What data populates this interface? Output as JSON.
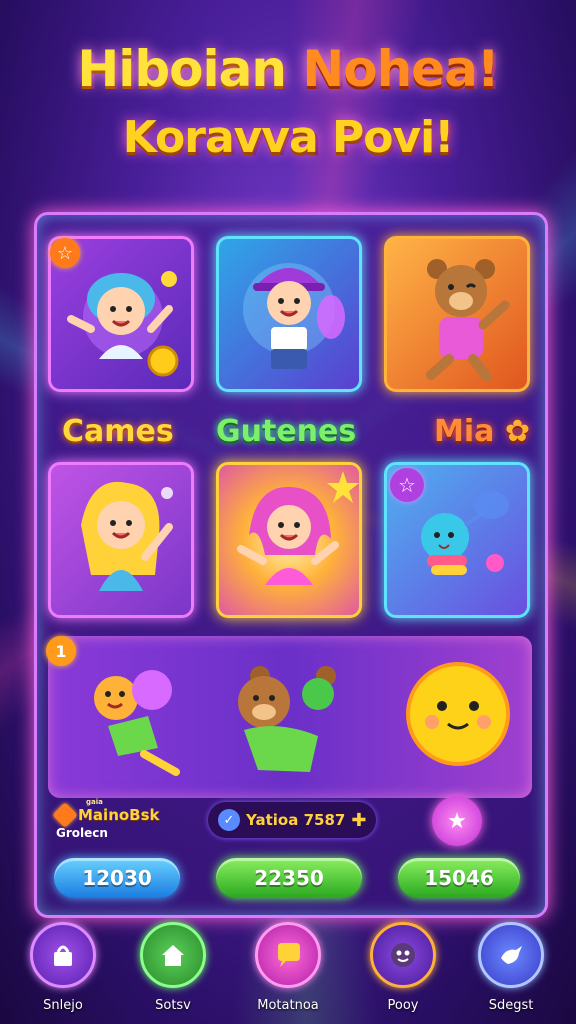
{
  "title": {
    "line1_a": "Hiboian",
    "line1_b": "Nohea!",
    "line2": "Koravva Povi!"
  },
  "categories": [
    "Cames",
    "Gutenes",
    "Mia"
  ],
  "cards": [
    {
      "badge": "☆"
    },
    {},
    {},
    {},
    {},
    {
      "badge": "☆"
    }
  ],
  "featured": {
    "badge": "1"
  },
  "info": {
    "left_title": "MainoBsk",
    "left_tiny": "gaia",
    "left_sub": "Grolecn",
    "center_text": "Yatioa 7587"
  },
  "buttons": [
    "12030",
    "22350",
    "15046"
  ],
  "nav": [
    {
      "label": "Snlejo",
      "icon": "shop-icon"
    },
    {
      "label": "Sotsv",
      "icon": "house-icon"
    },
    {
      "label": "Motatnoa",
      "icon": "chat-bubble-icon"
    },
    {
      "label": "Pooy",
      "icon": "face-icon"
    },
    {
      "label": "Sdegst",
      "icon": "bird-icon"
    }
  ],
  "colors": {
    "panel_border": "#d77cff",
    "accent_blue": "#1a7ce0",
    "accent_green": "#2aa820",
    "title_yellow": "#ffe23a"
  }
}
